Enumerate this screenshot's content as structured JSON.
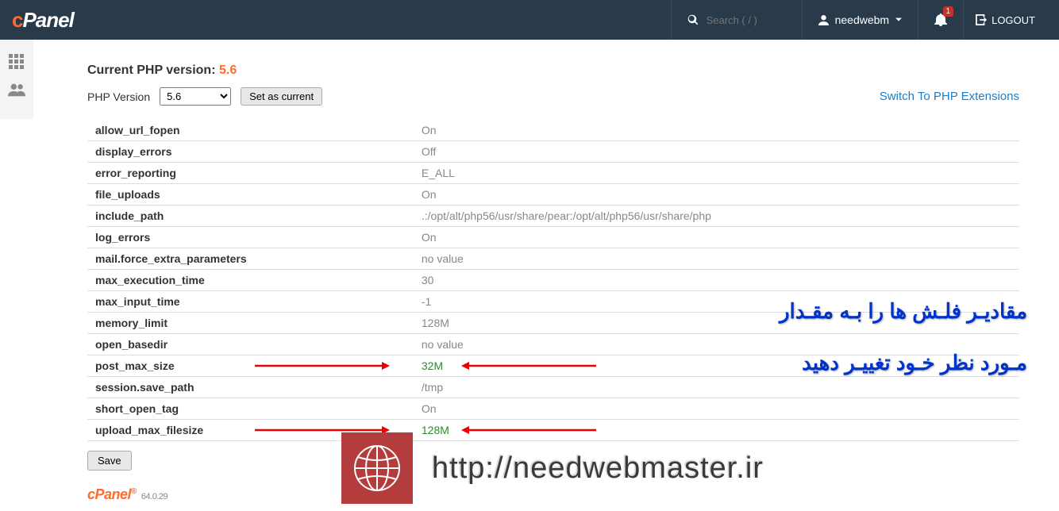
{
  "header": {
    "logo_text": "cPanel",
    "search_placeholder": "Search ( / )",
    "username": "needwebm",
    "notification_count": "1",
    "logout_label": "LOGOUT"
  },
  "php": {
    "current_label": "Current PHP version:",
    "current_version": "5.6",
    "version_label": "PHP Version",
    "selected_version": "5.6",
    "set_current_label": "Set as current",
    "switch_label": "Switch To PHP Extensions"
  },
  "options": [
    {
      "name": "allow_url_fopen",
      "value": "On",
      "highlight": false
    },
    {
      "name": "display_errors",
      "value": "Off",
      "highlight": false
    },
    {
      "name": "error_reporting",
      "value": "E_ALL",
      "highlight": false
    },
    {
      "name": "file_uploads",
      "value": "On",
      "highlight": false
    },
    {
      "name": "include_path",
      "value": ".:/opt/alt/php56/usr/share/pear:/opt/alt/php56/usr/share/php",
      "highlight": false
    },
    {
      "name": "log_errors",
      "value": "On",
      "highlight": false
    },
    {
      "name": "mail.force_extra_parameters",
      "value": "no value",
      "highlight": false
    },
    {
      "name": "max_execution_time",
      "value": "30",
      "highlight": false
    },
    {
      "name": "max_input_time",
      "value": "-1",
      "highlight": false
    },
    {
      "name": "memory_limit",
      "value": "128M",
      "highlight": false
    },
    {
      "name": "open_basedir",
      "value": "no value",
      "highlight": false
    },
    {
      "name": "post_max_size",
      "value": "32M",
      "highlight": true
    },
    {
      "name": "session.save_path",
      "value": "/tmp",
      "highlight": false
    },
    {
      "name": "short_open_tag",
      "value": "On",
      "highlight": false
    },
    {
      "name": "upload_max_filesize",
      "value": "128M",
      "highlight": true
    }
  ],
  "save_label": "Save",
  "footer": {
    "logo": "cPanel",
    "version": "64.0.29"
  },
  "overlay": {
    "line1": "مقادیـر فلـش ها را بـه مقـدار",
    "line2": "مـورد نظر خـود تغییـر دهید",
    "url": "http://needwebmaster.ir"
  }
}
